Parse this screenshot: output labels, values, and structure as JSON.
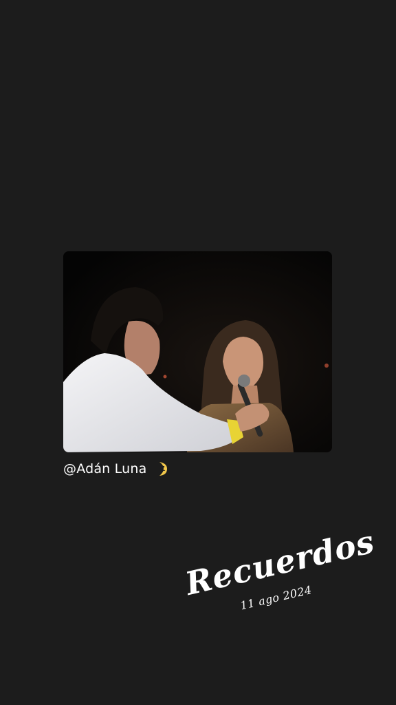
{
  "story": {
    "background_color": "#1c1c1c",
    "media": {
      "icon": "video-frame"
    },
    "mention": {
      "text": "@Adán Luna",
      "emoji": "moon-icon"
    },
    "sticker": {
      "title": "Recuerdos",
      "date": "11 ago 2024"
    }
  }
}
